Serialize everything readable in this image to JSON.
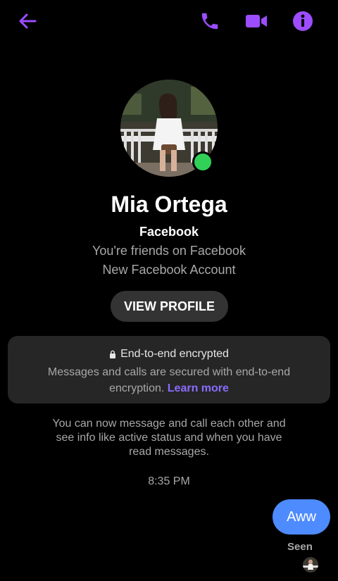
{
  "header": {
    "back_icon": "arrow-left-icon",
    "call_icon": "phone-icon",
    "video_icon": "video-camera-icon",
    "info_icon": "info-icon",
    "accent_color": "#9b4dff"
  },
  "profile": {
    "name": "Mia Ortega",
    "platform": "Facebook",
    "friends_text": "You're friends on Facebook",
    "account_text": "New Facebook Account",
    "status": "online",
    "view_profile_label": "VIEW PROFILE"
  },
  "encryption": {
    "title": "End-to-end encrypted",
    "body": "Messages and calls are secured with end-to-end encryption.",
    "link": "Learn more"
  },
  "notice": "You can now message and call each other and see info like active status and when you have read messages.",
  "timestamp": "8:35 PM",
  "messages": [
    {
      "text": "Aww",
      "sender": "me",
      "color": "#4e8bff"
    }
  ],
  "seen_label": "Seen"
}
